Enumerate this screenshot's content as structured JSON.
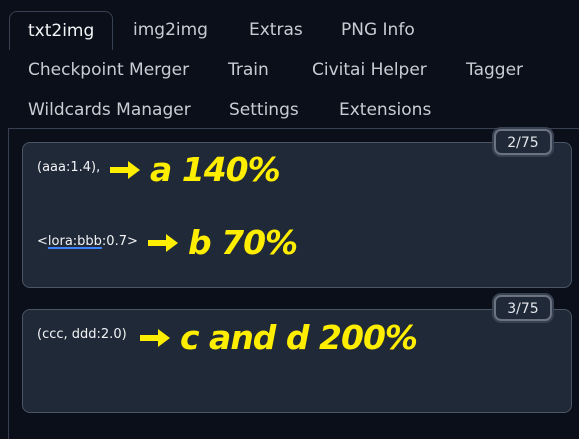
{
  "tabs": [
    {
      "label": "txt2img",
      "active": true
    },
    {
      "label": "img2img"
    },
    {
      "label": "Extras"
    },
    {
      "label": "PNG Info"
    },
    {
      "label": "Checkpoint Merger"
    },
    {
      "label": "Train"
    },
    {
      "label": "Civitai Helper"
    },
    {
      "label": "Tagger"
    },
    {
      "label": "Wildcards Manager"
    },
    {
      "label": "Settings"
    },
    {
      "label": "Extensions"
    }
  ],
  "positive_prompt": {
    "token_counter": "2/75",
    "line1": "(aaa:1.4),",
    "line2_prefix": "<",
    "line2_word": "lora:bbb",
    "line2_suffix": ":0.7>"
  },
  "negative_prompt": {
    "token_counter": "3/75",
    "line1": "(ccc, ddd:2.0)"
  },
  "annotations": {
    "a": "a 140%",
    "b": "b 70%",
    "cd": "c and d 200%",
    "color": "#ffee00"
  },
  "icons": {
    "arrow": "arrow-right-icon"
  }
}
